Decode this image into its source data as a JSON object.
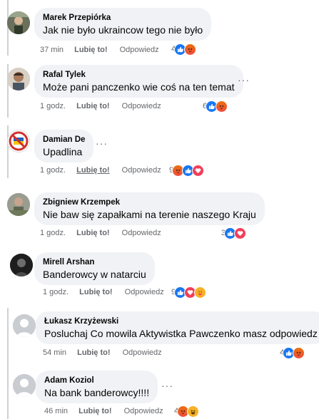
{
  "comments": [
    {
      "author": "Marek Przepiórka",
      "text": "Jak nie było ukraincow tego nie było",
      "time": "37 min",
      "like": "Lubię to!",
      "reply": "Odpowiedz",
      "count": "4",
      "reactions": [
        "like-icon",
        "angry-icon"
      ]
    },
    {
      "author": "Rafal Tylek",
      "text": "Może pani panczenko wie coś na ten temat",
      "time": "1 godz.",
      "like": "Lubię to!",
      "reply": "Odpowiedz",
      "count": "6",
      "reactions": [
        "like-icon",
        "angry-icon"
      ]
    },
    {
      "author": "Damian De",
      "text": "Upadlina",
      "time": "1 godz.",
      "like": "Lubię to!",
      "reply": "Odpowiedz",
      "count": "9",
      "reactions": [
        "angry-icon",
        "like-icon",
        "love-icon"
      ]
    },
    {
      "author": "Zbigniew Krzempek",
      "text": "Nie baw się zapałkami na terenie naszego Kraju",
      "time": "1 godz.",
      "like": "Lubię to!",
      "reply": "Odpowiedz",
      "count": "3",
      "reactions": [
        "like-icon",
        "love-icon"
      ]
    },
    {
      "author": "Mirell Arshan",
      "text": "Banderowcy w natarciu",
      "time": "1 godz.",
      "like": "Lubię to!",
      "reply": "Odpowiedz",
      "count": "9",
      "reactions": [
        "like-icon",
        "love-icon",
        "care-icon"
      ]
    },
    {
      "author": "Łukasz Krzyżewski",
      "text": "Posluchaj Co mowila Aktywistka Pawczenko masz odpowiedz",
      "time": "54 min",
      "like": "Lubię to!",
      "reply": "Odpowiedz",
      "count": "4",
      "reactions": [
        "like-icon",
        "angry-icon"
      ]
    },
    {
      "author": "Adam Koziol",
      "text": "Na bank banderowcy!!!!",
      "time": "46 min",
      "like": "Lubię to!",
      "reply": "Odpowiedz",
      "count": "4",
      "reactions": [
        "angry-icon",
        "haha-icon"
      ]
    }
  ],
  "colors": {
    "like": "#1877f2",
    "angry": "#f04a3d",
    "love": "#f33e58",
    "haha": "#f7b125",
    "meta": "#65676b",
    "bubble": "#f0f2f5"
  },
  "more_label": "···"
}
